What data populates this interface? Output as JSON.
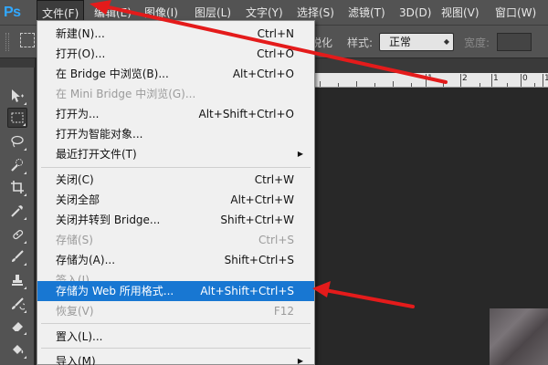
{
  "app": {
    "logo": "Ps"
  },
  "menubar": {
    "items": [
      {
        "label": "文件(F)"
      },
      {
        "label": "编辑(E)"
      },
      {
        "label": "图像(I)"
      },
      {
        "label": "图层(L)"
      },
      {
        "label": "文字(Y)"
      },
      {
        "label": "选择(S)"
      },
      {
        "label": "滤镜(T)"
      },
      {
        "label": "3D(D)"
      },
      {
        "label": "视图(V)"
      },
      {
        "label": "窗口(W)"
      }
    ]
  },
  "options_bar": {
    "partial_text": "锐化",
    "style_label": "样式:",
    "style_value": "正常",
    "width_label": "宽度:"
  },
  "ruler": {
    "labels": [
      "1",
      "2",
      "1",
      "0",
      "1"
    ]
  },
  "file_menu": {
    "items": [
      {
        "label": "新建(N)...",
        "shortcut": "Ctrl+N"
      },
      {
        "label": "打开(O)...",
        "shortcut": "Ctrl+O"
      },
      {
        "label": "在 Bridge 中浏览(B)...",
        "shortcut": "Alt+Ctrl+O"
      },
      {
        "label": "在 Mini Bridge 中浏览(G)...",
        "shortcut": ""
      },
      {
        "label": "打开为...",
        "shortcut": "Alt+Shift+Ctrl+O"
      },
      {
        "label": "打开为智能对象...",
        "shortcut": ""
      },
      {
        "label": "最近打开文件(T)",
        "shortcut": ""
      },
      {
        "label": "关闭(C)",
        "shortcut": "Ctrl+W"
      },
      {
        "label": "关闭全部",
        "shortcut": "Alt+Ctrl+W"
      },
      {
        "label": "关闭并转到 Bridge...",
        "shortcut": "Shift+Ctrl+W"
      },
      {
        "label": "存储(S)",
        "shortcut": "Ctrl+S"
      },
      {
        "label": "存储为(A)...",
        "shortcut": "Shift+Ctrl+S"
      },
      {
        "label": "签入(I)...",
        "shortcut": ""
      },
      {
        "label": "存储为 Web 所用格式...",
        "shortcut": "Alt+Shift+Ctrl+S"
      },
      {
        "label": "恢复(V)",
        "shortcut": "F12"
      },
      {
        "label": "置入(L)...",
        "shortcut": ""
      },
      {
        "label": "导入(M)",
        "shortcut": ""
      }
    ]
  },
  "colors": {
    "highlight": "#1877d2",
    "arrow": "#e41b1b",
    "logo": "#31a8ff"
  },
  "tools": [
    "move-icon",
    "rect-marquee-icon",
    "lasso-icon",
    "quick-select-icon",
    "crop-icon",
    "eyedropper-icon",
    "healing-brush-icon",
    "brush-icon",
    "clone-stamp-icon",
    "history-brush-icon",
    "eraser-icon",
    "paint-bucket-icon"
  ]
}
